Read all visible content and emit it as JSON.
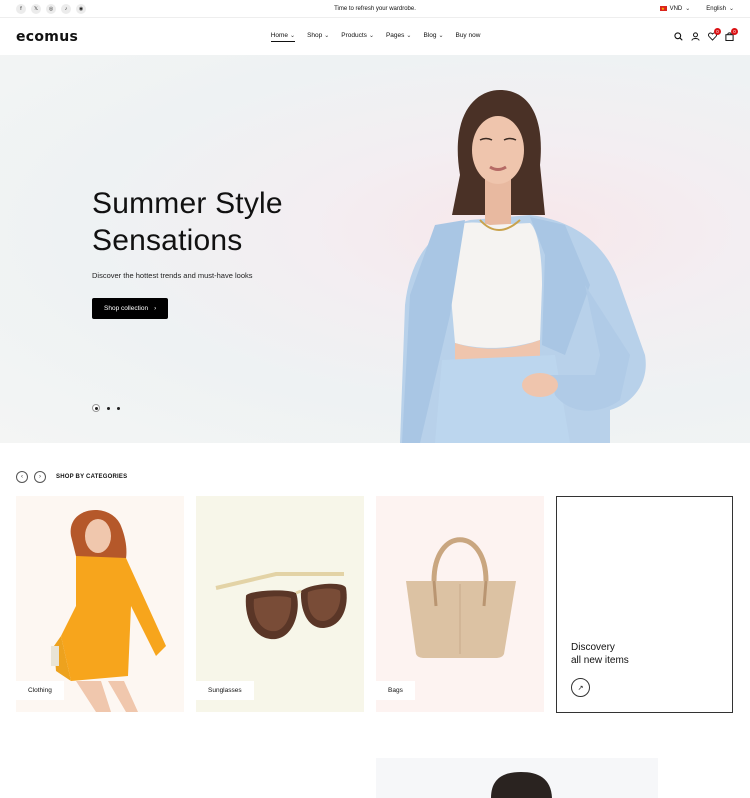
{
  "topbar": {
    "social": [
      "f",
      "𝕏",
      "◎",
      "♪",
      "◉"
    ],
    "announcement": "Time to refresh your wardrobe.",
    "currency": "VND",
    "language": "English"
  },
  "header": {
    "logo": "ecomus",
    "nav": [
      {
        "label": "Home",
        "dropdown": true
      },
      {
        "label": "Shop",
        "dropdown": true
      },
      {
        "label": "Products",
        "dropdown": true
      },
      {
        "label": "Pages",
        "dropdown": true
      },
      {
        "label": "Blog",
        "dropdown": true
      },
      {
        "label": "Buy now",
        "dropdown": false
      }
    ],
    "wishlist_count": "0",
    "cart_count": "0"
  },
  "hero": {
    "title_line1": "Summer Style",
    "title_line2": "Sensations",
    "subtitle": "Discover the hottest trends and must-have looks",
    "button": "Shop collection",
    "slide_count": 3,
    "active_slide": 1
  },
  "categories": {
    "title": "SHOP BY CATEGORIES",
    "items": [
      {
        "label": "Clothing",
        "bg": "#fdf7f2"
      },
      {
        "label": "Sunglasses",
        "bg": "#f7f6e9"
      },
      {
        "label": "Bags",
        "bg": "#fdf3f1"
      }
    ],
    "discover_line1": "Discovery",
    "discover_line2": "all new items"
  }
}
